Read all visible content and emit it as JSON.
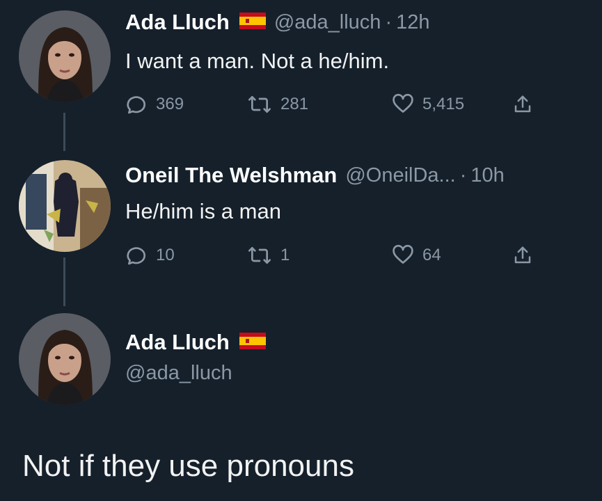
{
  "colors": {
    "background": "#15202b",
    "primary_text": "#ffffff",
    "secondary_text": "#8b98a5",
    "connector": "#3d4a57"
  },
  "tweets": [
    {
      "display_name": "Ada Lluch",
      "flag_icon": "spain-flag-icon",
      "handle": "@ada_lluch",
      "separator": "·",
      "time": "12h",
      "text": "I want a man. Not a he/him.",
      "replies": "369",
      "retweets": "281",
      "likes": "5,415"
    },
    {
      "display_name": "Oneil The Welshman",
      "handle": "@OneilDa...",
      "separator": "·",
      "time": "10h",
      "text": "He/him is a man",
      "replies": "10",
      "retweets": "1",
      "likes": "64"
    }
  ],
  "focal_tweet": {
    "display_name": "Ada Lluch",
    "flag_icon": "spain-flag-icon",
    "handle": "@ada_lluch",
    "text": "Not if they use pronouns"
  },
  "icons": {
    "reply": "reply-icon",
    "retweet": "retweet-icon",
    "like": "heart-icon",
    "share": "share-icon"
  }
}
